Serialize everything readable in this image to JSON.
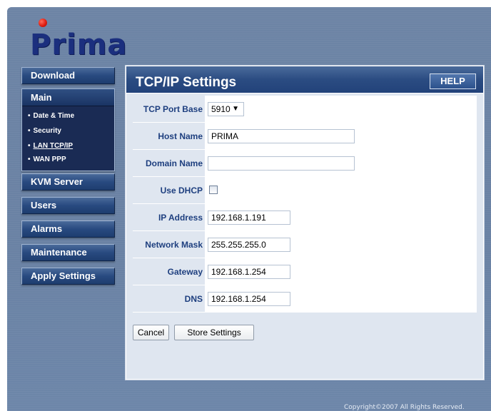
{
  "brand": {
    "logo_text": "Prima"
  },
  "nav": {
    "download": "Download",
    "main": "Main",
    "main_items": [
      {
        "label": "Date & Time"
      },
      {
        "label": "Security"
      },
      {
        "label": "LAN TCP/IP"
      },
      {
        "label": "WAN PPP"
      }
    ],
    "kvm_server": "KVM Server",
    "users": "Users",
    "alarms": "Alarms",
    "maintenance": "Maintenance",
    "apply_settings": "Apply Settings"
  },
  "panel": {
    "title": "TCP/IP Settings",
    "help_label": "HELP"
  },
  "form": {
    "tcp_port_base_label": "TCP Port Base",
    "tcp_port_base_value": "5910",
    "host_name_label": "Host Name",
    "host_name_value": "PRIMA",
    "domain_name_label": "Domain Name",
    "domain_name_value": "",
    "use_dhcp_label": "Use DHCP",
    "use_dhcp_checked": false,
    "ip_address_label": "IP Address",
    "ip_address_value": "192.168.1.191",
    "network_mask_label": "Network Mask",
    "network_mask_value": "255.255.255.0",
    "gateway_label": "Gateway",
    "gateway_value": "192.168.1.254",
    "dns_label": "DNS",
    "dns_value": "192.168.1.254"
  },
  "actions": {
    "cancel_label": "Cancel",
    "store_label": "Store Settings"
  },
  "footer": {
    "copyright": "Copyright©2007  All Rights Reserved."
  }
}
